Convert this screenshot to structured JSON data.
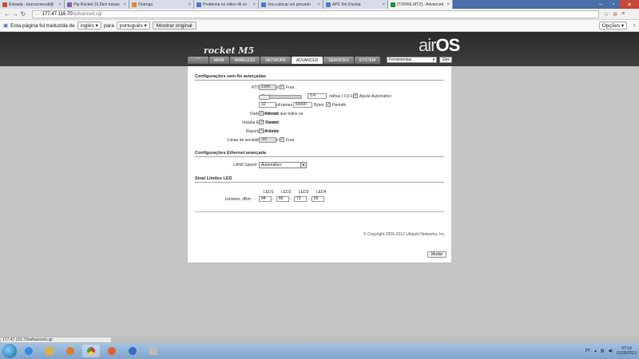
{
  "browser": {
    "tabs": [
      {
        "title": "Entrada - brunocmeruti@",
        "color": "#d04a3a"
      },
      {
        "title": "Ptp Rocket 31,5km travan",
        "color": "#8a5aa8"
      },
      {
        "title": "Outorga",
        "color": "#e08a2a"
      },
      {
        "title": "Problema no mikro tik co",
        "color": "#4a7ac0"
      },
      {
        "title": "Vou colocar um provedo",
        "color": "#4a7ac0"
      },
      {
        "title": "APC 5m Duvida",
        "color": "#4a7ac0"
      },
      {
        "title": "[TORRE.MTZ] - Advanced",
        "color": "#2a8a3a"
      }
    ],
    "url_host": "177.47.116.70",
    "url_path": "/advanced.cgi",
    "translate": {
      "message": "Esta página foi traduzida de",
      "from_lang": "inglês",
      "to_word": "para",
      "to_lang": "português",
      "show_original": "Mostrar original",
      "options": "Opções"
    },
    "status_url": "177.47.116.70/advanced.cgi"
  },
  "header": {
    "product": "rocket M5",
    "brand_air": "air",
    "brand_os": "OS",
    "tabs": [
      "MAIN",
      "WIRELESS",
      "NETWORK",
      "ADVANCED",
      "SERVICES",
      "SYSTEM"
    ],
    "tools_select": "Ferramentas",
    "tools_go": "Ger"
  },
  "advanced": {
    "wireless_section": "Configurações sem fio avançadas",
    "rts_label": "RTS Threshold:",
    "rts_value": "2346",
    "rts_off": "Fora",
    "distance_label": "Distância:",
    "distance_value": "0.4",
    "distance_unit": "milhas ( 0,6 km)",
    "auto_adjust": "Ajuste Automático",
    "aggregation_label": "Agregação:",
    "agg_frames": "32",
    "frames_word": "Frames",
    "agg_bytes": "50000",
    "bytes_word": "Bytes",
    "allow": "Permitir",
    "multicast_label": "Dados Multicast:",
    "multicast_allow": "Permitir que todos os",
    "erp_label": "Instalar ERP Control:",
    "erp_allow": "Permitir",
    "extra_label": "Reportagem Extra:",
    "extra_allow": "Permitir",
    "sensitivity_label": "Limiar de sensibilidade, dBm:",
    "sensitivity_value": "-96",
    "sensitivity_off": "Fora",
    "ethernet_section": "Configurações Ethernet avançada",
    "lan_speed_label": "LAN0 Speed:",
    "lan_speed_value": "Automático",
    "led_section": "Sinal Limites LED",
    "led_headers": [
      "LED1",
      "LED2",
      "LED3",
      "LED4"
    ],
    "led_row_label": "Limiares, dBm:",
    "led_values": [
      "94",
      "80",
      "73",
      "65"
    ],
    "change_button": "Mudar",
    "copyright": "© Copyright 2006-2012 Ubiquiti Networks, Inc."
  },
  "taskbar": {
    "lang": "PT",
    "time": "07:14",
    "date": "01/05/2013"
  }
}
